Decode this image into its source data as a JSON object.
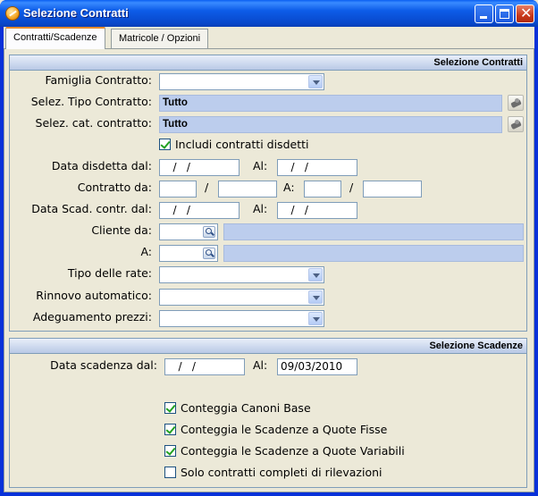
{
  "window": {
    "title": "Selezione Contratti"
  },
  "tabs": [
    {
      "label": "Contratti/Scadenze"
    },
    {
      "label": "Matricole / Opzioni"
    }
  ],
  "contratti": {
    "header": "Selezione Contratti",
    "famiglia_label": "Famiglia Contratto:",
    "famiglia_value": "",
    "tipo_label": "Selez. Tipo Contratto:",
    "tipo_value": "Tutto",
    "cat_label": "Selez. cat. contratto:",
    "cat_value": "Tutto",
    "includi_label": "Includi contratti disdetti",
    "includi_checked": true,
    "disdetta_label": "Data disdetta dal:",
    "disdetta_from": "   /   /",
    "al_label": "Al:",
    "disdetta_to": "   /   /",
    "contratto_da_label": "Contratto da:",
    "slash": "/",
    "a_label": "A:",
    "scad_label": "Data Scad. contr. dal:",
    "scad_from": "   /   /",
    "scad_to": "   /   /",
    "cliente_da_label": "Cliente da:",
    "cliente_a_label": "A:",
    "tipo_rate_label": "Tipo delle rate:",
    "rinnovo_label": "Rinnovo automatico:",
    "adeguamento_label": "Adeguamento prezzi:"
  },
  "scadenze": {
    "header": "Selezione Scadenze",
    "data_label": "Data scadenza dal:",
    "data_from": "   /   /",
    "al_label": "Al:",
    "data_to": "09/03/2010",
    "checks": [
      {
        "label": "Conteggia Canoni Base",
        "checked": true
      },
      {
        "label": "Conteggia le Scadenze a Quote Fisse",
        "checked": true
      },
      {
        "label": "Conteggia le Scadenze a Quote Variabili",
        "checked": true
      },
      {
        "label": "Solo contratti completi di rilevazioni",
        "checked": false
      }
    ]
  },
  "colors": {
    "titlebar": "#0A50DC",
    "tab_accent": "#E68B2C",
    "readonly_field": "#BCCDED",
    "check": "#21A121"
  }
}
